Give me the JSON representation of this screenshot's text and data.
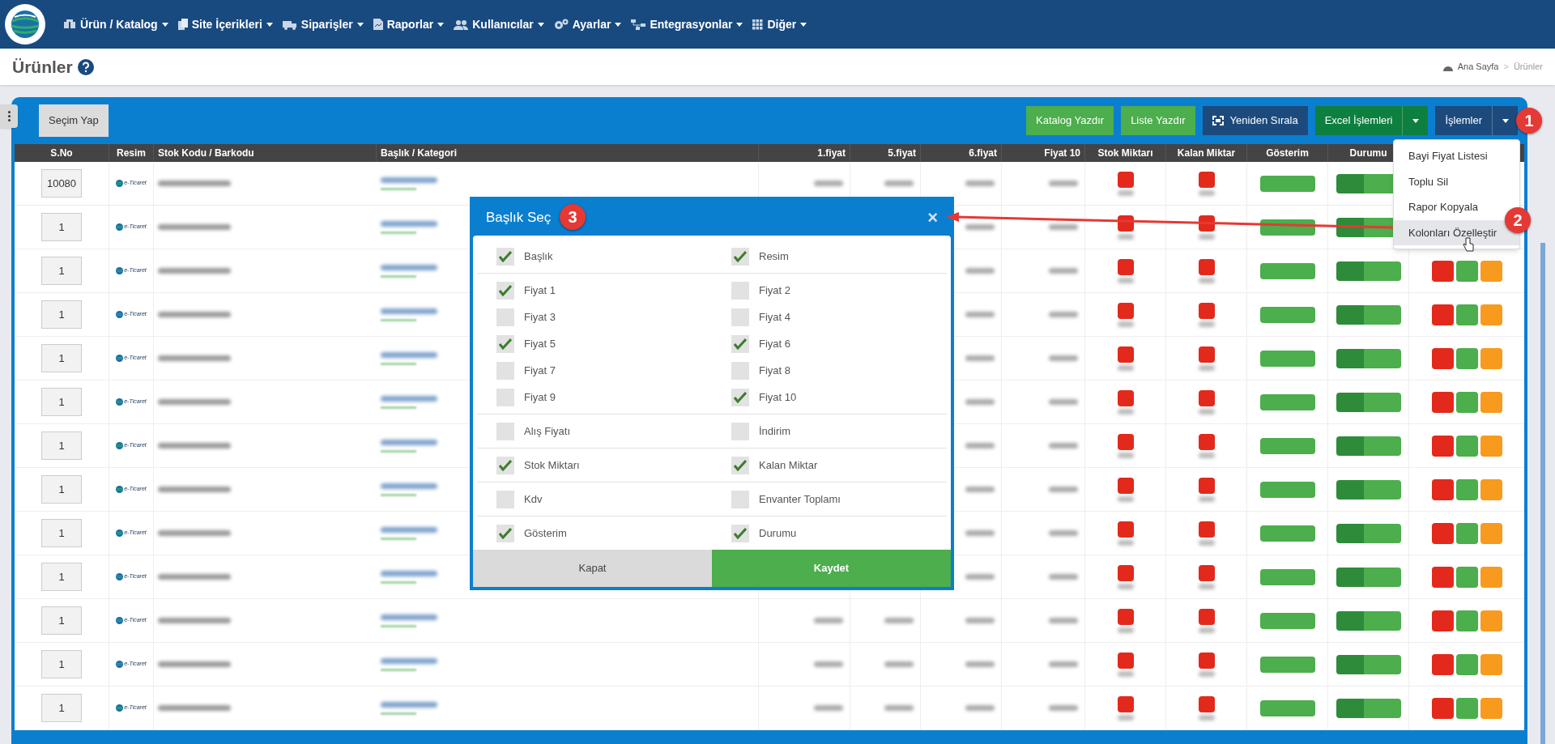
{
  "nav": {
    "items": [
      {
        "label": "Ürün / Katalog",
        "kind": "boxes"
      },
      {
        "label": "Site İçerikleri",
        "kind": "files"
      },
      {
        "label": "Siparişler",
        "kind": "truck"
      },
      {
        "label": "Raporlar",
        "kind": "report"
      },
      {
        "label": "Kullanıcılar",
        "kind": "users"
      },
      {
        "label": "Ayarlar",
        "kind": "gears"
      },
      {
        "label": "Entegrasyonlar",
        "kind": "sitemap"
      },
      {
        "label": "Diğer",
        "kind": "grid"
      }
    ]
  },
  "page": {
    "title": "Ürünler",
    "breadcrumb": [
      "Ana Sayfa",
      ">",
      "Ürünler"
    ]
  },
  "toolbar": {
    "left_button": "Seçim Yap",
    "buttons": [
      {
        "label": "Katalog Yazdır",
        "kind": "green"
      },
      {
        "label": "Liste Yazdır",
        "kind": "green"
      },
      {
        "label": "Yeniden Sırala",
        "kind": "navy-icon"
      },
      {
        "label": "Excel İşlemleri",
        "kind": "split-green"
      },
      {
        "label": "İşlemler",
        "kind": "split-navy"
      }
    ]
  },
  "table": {
    "columns": [
      "S.No",
      "Resim",
      "Stok Kodu / Barkodu",
      "Başlık / Kategori",
      "1.fiyat",
      "5.fiyat",
      "6.fiyat",
      "Fiyat 10",
      "Stok Miktarı",
      "Kalan Miktar",
      "Gösterim",
      "Durumu"
    ],
    "rows": [
      {
        "sno": "10080",
        "logo": "e-Ticaret"
      },
      {
        "sno": "1",
        "logo": "e-Ticaret"
      },
      {
        "sno": "1",
        "logo": "e-Ticaret"
      },
      {
        "sno": "1",
        "logo": "e-Ticaret"
      },
      {
        "sno": "1",
        "logo": "e-Ticaret"
      },
      {
        "sno": "1",
        "logo": "e-Ticaret"
      },
      {
        "sno": "1",
        "logo": "e-Ticaret"
      },
      {
        "sno": "1",
        "logo": "e-Ticaret"
      },
      {
        "sno": "1",
        "logo": "e-Ticaret"
      },
      {
        "sno": "1",
        "logo": "e-Ticaret"
      },
      {
        "sno": "1",
        "logo": "e-Ticaret"
      },
      {
        "sno": "1",
        "logo": "e-Ticaret"
      },
      {
        "sno": "1",
        "logo": "e-Ticaret"
      }
    ]
  },
  "dropdown": {
    "items": [
      {
        "label": "Bayi Fiyat Listesi",
        "selected": false
      },
      {
        "label": "Toplu Sil",
        "selected": false
      },
      {
        "label": "Rapor Kopyala",
        "selected": false
      },
      {
        "label": "Kolonları Özelleştir",
        "selected": true
      }
    ]
  },
  "modal": {
    "title": "Başlık Seç",
    "close": "×",
    "groups": [
      [
        {
          "label": "Başlık",
          "checked": true
        },
        {
          "label": "Resim",
          "checked": true
        }
      ],
      [
        {
          "label": "Fiyat 1",
          "checked": true
        },
        {
          "label": "Fiyat 2",
          "checked": false
        },
        {
          "label": "Fiyat 3",
          "checked": false
        },
        {
          "label": "Fiyat 4",
          "checked": false
        },
        {
          "label": "Fiyat 5",
          "checked": true
        },
        {
          "label": "Fiyat 6",
          "checked": true
        },
        {
          "label": "Fiyat 7",
          "checked": false
        },
        {
          "label": "Fiyat 8",
          "checked": false
        },
        {
          "label": "Fiyat 9",
          "checked": false
        },
        {
          "label": "Fiyat 10",
          "checked": true
        }
      ],
      [
        {
          "label": "Alış Fiyatı",
          "checked": false
        },
        {
          "label": "İndirim",
          "checked": false
        }
      ],
      [
        {
          "label": "Stok Miktarı",
          "checked": true
        },
        {
          "label": "Kalan Miktar",
          "checked": true
        }
      ],
      [
        {
          "label": "Kdv",
          "checked": false
        },
        {
          "label": "Envanter Toplamı",
          "checked": false
        }
      ],
      [
        {
          "label": "Gösterim",
          "checked": true
        },
        {
          "label": "Durumu",
          "checked": true
        }
      ]
    ],
    "buttons": [
      {
        "label": "Kapat",
        "kind": "secondary"
      },
      {
        "label": "Kaydet",
        "kind": "primary"
      }
    ]
  },
  "badges": [
    "1",
    "2",
    "3"
  ]
}
